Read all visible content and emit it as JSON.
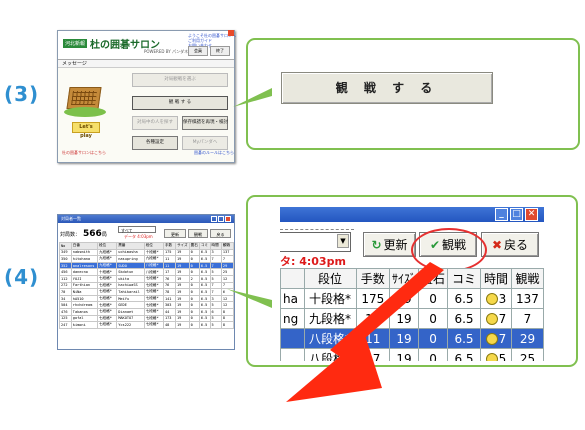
{
  "steps": {
    "step3_label": "(3)",
    "step4_label": "(4)"
  },
  "step3": {
    "thumbnail": {
      "badge": "河北新報",
      "title": "杜の囲碁サロン",
      "powered": "POWERED BY パンダネット",
      "top_links": [
        "ようこそ杜の囲碁サロンへ",
        "ご利用ガイド",
        "お問い合わせ"
      ],
      "top_buttons": [
        "会員",
        "終了"
      ],
      "message_bar": "メッセージ",
      "buttons": [
        {
          "label": "対局観戦を選ぶ",
          "enabled": false
        },
        {
          "label": "観 戦 す る",
          "enabled": true
        },
        {
          "label": "対局中の人を探す",
          "enabled": false
        },
        {
          "label": "保存棋譜を再現・検討",
          "enabled": true
        },
        {
          "label": "各種設定",
          "enabled": true
        },
        {
          "label": "Myパンダへ",
          "enabled": false
        }
      ],
      "lets_play": "Let's play",
      "footer_left": "杜の囲碁サロンはこちら",
      "footer_right": "囲碁のルールはこちら"
    },
    "callout_button": "観 戦 す る"
  },
  "step4": {
    "thumbnail": {
      "window_title": "対局者一覧",
      "count_label": "対局数：",
      "count_value": "566",
      "count_unit": "局",
      "filter_value": "すべて",
      "red_text": "データ 4:03pm",
      "buttons": [
        "更新",
        "観戦",
        "戻る"
      ],
      "columns": [
        "No",
        "白番",
        "段位",
        "黒番",
        "段位",
        "手数",
        "サイズ",
        "置石",
        "コミ",
        "時間",
        "観戦"
      ],
      "rows": [
        [
          "349",
          "nabsmith",
          "九段格*",
          "uchimasha",
          "十段格*",
          "175",
          "19",
          "0",
          "6.5",
          "3",
          "137"
        ],
        [
          "350",
          "hitohana",
          "九段格*",
          "nasupring",
          "九段格*",
          "11",
          "19",
          "0",
          "6.5",
          "7",
          "7"
        ],
        [
          "352",
          "analresons",
          "九段格*",
          "SUDO",
          "八段格*",
          "11",
          "19",
          "0",
          "6.5",
          "7",
          "29"
        ],
        [
          "456",
          "danecno",
          "十段格*",
          "Skdotun",
          "八段格*",
          "17",
          "19",
          "0",
          "6.5",
          "5",
          "25"
        ],
        [
          "112",
          "YOJI",
          "七段格*",
          "ukita",
          "七段格*",
          "76",
          "19",
          "2",
          "0.5",
          "5",
          "12"
        ],
        [
          "272",
          "Farthian",
          "七段格*",
          "hachiwaSS",
          "七段格*",
          "76",
          "19",
          "0",
          "6.5",
          "7",
          "7"
        ],
        [
          "70",
          "NiNa",
          "七段格*",
          "Tahikarail",
          "七段格*",
          "78",
          "19",
          "0",
          "6.5",
          "7",
          "6"
        ],
        [
          "34",
          "hA510",
          "七段格*",
          "MeiYu",
          "七段格*",
          "141",
          "19",
          "0",
          "6.5",
          "3",
          "12"
        ],
        [
          "504",
          "rhchdream",
          "七段格*",
          "GEDE",
          "七段格*",
          "303",
          "19",
          "0",
          "6.5",
          "5",
          "12"
        ],
        [
          "476",
          "Takanos",
          "七段格*",
          "Dianaet",
          "七段格*",
          "44",
          "19",
          "0",
          "6.5",
          "6",
          "8"
        ],
        [
          "125",
          "gofal",
          "七段格*",
          "MAKOTO7",
          "七段格*",
          "173",
          "19",
          "0",
          "6.5",
          "5",
          "8"
        ],
        [
          "247",
          "kimoni",
          "七段格*",
          "Ycs222",
          "七段格*",
          "48",
          "19",
          "0",
          "6.5",
          "5",
          "8"
        ]
      ],
      "selected_row_index": 2
    },
    "zoom": {
      "red_text": "タ: 4:03pm",
      "buttons": [
        {
          "icon": "↻",
          "label": "更新"
        },
        {
          "icon": "✔",
          "label": "観戦"
        },
        {
          "icon": "✖",
          "label": "戻る"
        }
      ],
      "columns": [
        "",
        "段位",
        "手数",
        "ｻｲｽﾞ",
        "置石",
        "コミ",
        "時間",
        "観戦"
      ],
      "rows": [
        [
          "ha",
          "十段格*",
          "175",
          "19",
          "0",
          "6.5",
          "3",
          "137"
        ],
        [
          "ng",
          "九段格*",
          "11",
          "19",
          "0",
          "6.5",
          "7",
          "7"
        ],
        [
          "",
          "八段格*",
          "11",
          "19",
          "0",
          "6.5",
          "7",
          "29"
        ],
        [
          "",
          "八段格*",
          "17",
          "19",
          "0",
          "6.5",
          "5",
          "25"
        ]
      ],
      "selected_row_index": 2
    }
  },
  "colors": {
    "step_label": "#2f8fd0",
    "callout_border": "#80c050",
    "highlight_ring": "#e63030",
    "arrow": "#ff2a10",
    "selection": "#3464c8"
  }
}
